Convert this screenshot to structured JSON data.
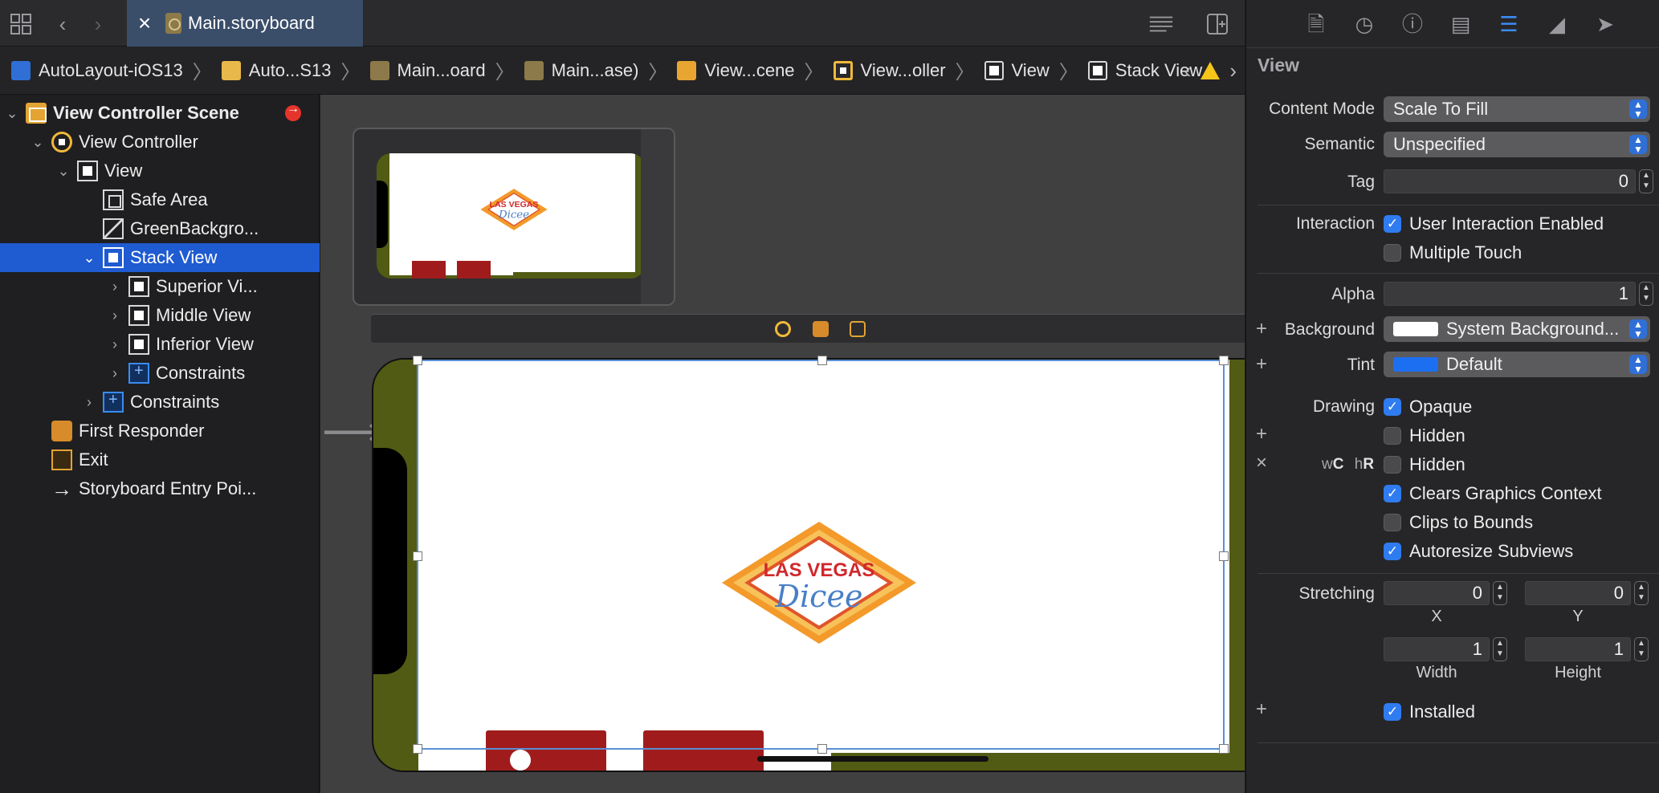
{
  "tabbar": {
    "file_tab_label": "Main.storyboard"
  },
  "breadcrumb": {
    "items": [
      "AutoLayout-iOS13",
      "Auto...S13",
      "Main...oard",
      "Main...ase)",
      "View...cene",
      "View...oller",
      "View",
      "Stack View"
    ]
  },
  "outline": {
    "items": [
      {
        "label": "View Controller Scene",
        "icon": "scene-icon"
      },
      {
        "label": "View Controller",
        "icon": "view-controller-icon"
      },
      {
        "label": "View",
        "icon": "view-icon"
      },
      {
        "label": "Safe Area",
        "icon": "safe-area-icon"
      },
      {
        "label": "GreenBackgro...",
        "icon": "image-view-icon"
      },
      {
        "label": "Stack View",
        "icon": "view-icon"
      },
      {
        "label": "Superior Vi...",
        "icon": "view-icon"
      },
      {
        "label": "Middle View",
        "icon": "view-icon"
      },
      {
        "label": "Inferior View",
        "icon": "view-icon"
      },
      {
        "label": "Constraints",
        "icon": "constraints-icon"
      },
      {
        "label": "Constraints",
        "icon": "constraints-icon"
      },
      {
        "label": "First Responder",
        "icon": "first-responder-icon"
      },
      {
        "label": "Exit",
        "icon": "exit-icon"
      },
      {
        "label": "Storyboard Entry Poi...",
        "icon": "entry-point-icon"
      }
    ],
    "selected": "Stack View"
  },
  "canvas": {
    "logo_line1": "LAS VEGAS",
    "logo_line2": "Dicee",
    "thumb_logo_line1": "LAS VEGAS",
    "thumb_logo_line2": "Dicee"
  },
  "inspector": {
    "section_title": "View",
    "content_mode": {
      "label": "Content Mode",
      "value": "Scale To Fill"
    },
    "semantic": {
      "label": "Semantic",
      "value": "Unspecified"
    },
    "tag": {
      "label": "Tag",
      "value": "0"
    },
    "interaction": {
      "label": "Interaction",
      "user_interaction_enabled": {
        "label": "User Interaction Enabled",
        "checked": true
      },
      "multiple_touch": {
        "label": "Multiple Touch",
        "checked": false
      }
    },
    "alpha": {
      "label": "Alpha",
      "value": "1"
    },
    "background": {
      "label": "Background",
      "value": "System Background...",
      "swatch": "#ffffff"
    },
    "tint": {
      "label": "Tint",
      "value": "Default",
      "swatch": "#1d6ff2"
    },
    "drawing": {
      "label": "Drawing",
      "opaque": {
        "label": "Opaque",
        "checked": true
      },
      "hidden": {
        "label": "Hidden",
        "checked": false
      },
      "size_class_prefix_w": "w",
      "size_class_w": "C",
      "size_class_prefix_h": "h",
      "size_class_h": "R",
      "hidden_variant": {
        "label": "Hidden",
        "checked": false
      },
      "clears_graphics_context": {
        "label": "Clears Graphics Context",
        "checked": true
      },
      "clips_to_bounds": {
        "label": "Clips to Bounds",
        "checked": false
      },
      "autoresize_subviews": {
        "label": "Autoresize Subviews",
        "checked": true
      }
    },
    "stretching": {
      "label": "Stretching",
      "x": {
        "value": "0",
        "label": "X"
      },
      "y": {
        "value": "0",
        "label": "Y"
      },
      "width": {
        "value": "1",
        "label": "Width"
      },
      "height": {
        "value": "1",
        "label": "Height"
      }
    },
    "installed": {
      "label": "Installed",
      "checked": true
    }
  }
}
